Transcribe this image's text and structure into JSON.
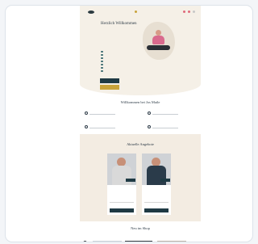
{
  "hero": {
    "title": "Herzlich Willkommen",
    "subtitle": "",
    "bullets": [
      "",
      "",
      "",
      "",
      "",
      "",
      ""
    ],
    "primary_button": "",
    "secondary_button": ""
  },
  "welcome_section": {
    "heading": "Willkommen bei Jos Maile",
    "features": [
      {
        "title": ""
      },
      {
        "title": ""
      },
      {
        "title": ""
      },
      {
        "title": ""
      }
    ]
  },
  "products_section": {
    "heading": "Aktuelle Angebote",
    "cards": [
      {
        "title": "",
        "price": ""
      },
      {
        "title": "",
        "price": ""
      }
    ]
  },
  "shop_section": {
    "heading": "Neu im Shop"
  },
  "colors": {
    "accent": "#c9a33a",
    "dark": "#1f3a44",
    "cream": "#f5f0e7"
  }
}
